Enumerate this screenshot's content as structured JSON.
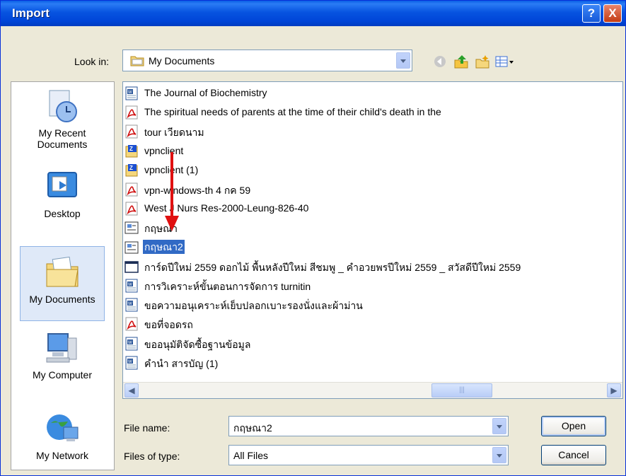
{
  "window": {
    "title": "Import"
  },
  "lookin": {
    "label": "Look in:",
    "value": "My Documents"
  },
  "places": [
    {
      "label": "My Recent Documents",
      "icon": "recent-documents-icon"
    },
    {
      "label": "Desktop",
      "icon": "desktop-icon"
    },
    {
      "label": "My Documents",
      "icon": "my-documents-icon"
    },
    {
      "label": "My Computer",
      "icon": "my-computer-icon"
    },
    {
      "label": "My Network",
      "icon": "my-network-icon"
    }
  ],
  "files": [
    {
      "name": "The Journal of Biochemistry",
      "type": "word"
    },
    {
      "name": "The spiritual needs of parents at the time of their child's death in the",
      "type": "pdf"
    },
    {
      "name": "tour เวียดนาม",
      "type": "pdf"
    },
    {
      "name": "vpnclient",
      "type": "zip"
    },
    {
      "name": "vpnclient (1)",
      "type": "zip"
    },
    {
      "name": "vpn-windows-th  4  กค 59",
      "type": "pdf"
    },
    {
      "name": "West J Nurs Res-2000-Leung-826-40",
      "type": "pdf"
    },
    {
      "name": "กฤษณา",
      "type": "ris"
    },
    {
      "name": "กฤษณา2",
      "type": "ris"
    },
    {
      "name": "การ์ดปีใหม่ 2559 ดอกไม้ พื้นหลังปีใหม่ สีชมพู _ คำอวยพรปีใหม่ 2559 _ สวัสดีปีใหม่ 2559",
      "type": "image"
    },
    {
      "name": "การวิเคราะห์ขั้นตอนการจัดการ turnitin",
      "type": "word"
    },
    {
      "name": "ขอความอนุเคราะห์เย็บปลอกเบาะรองนั่งและผ้าม่าน",
      "type": "word"
    },
    {
      "name": "ขอที่จอดรถ",
      "type": "pdf"
    },
    {
      "name": "ขออนุมัติจัดซื้อฐานข้อมูล",
      "type": "word"
    },
    {
      "name": "คำนำ สารบัญ (1)",
      "type": "word"
    }
  ],
  "selected_file": "กฤษณา2",
  "filename": {
    "label": "File name:",
    "value": "กฤษณา2"
  },
  "filetype": {
    "label": "Files of type:",
    "value": "All Files"
  },
  "buttons": {
    "open": "Open",
    "cancel": "Cancel",
    "help": "?",
    "close": "X"
  },
  "colors": {
    "selection": "#316ac5",
    "arrow": "#e01010",
    "titlebar": "#0754e0"
  }
}
